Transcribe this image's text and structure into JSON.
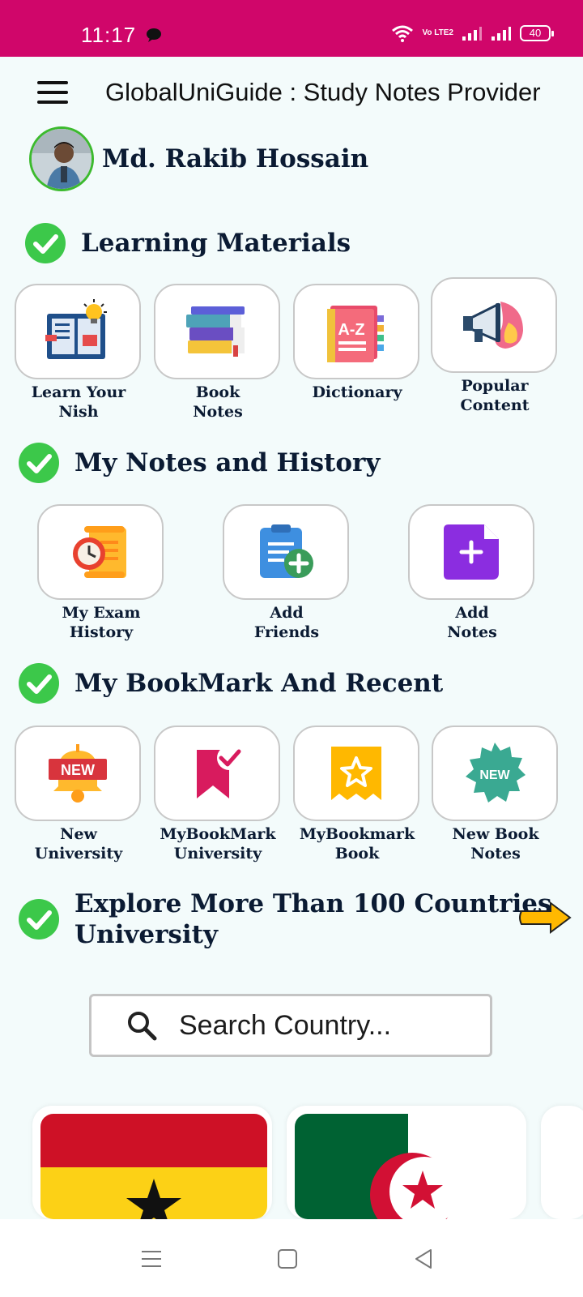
{
  "status": {
    "time": "11:17",
    "volte": "Vo LTE2",
    "battery": "40"
  },
  "app": {
    "title": "GlobalUniGuide : Study Notes Provider"
  },
  "profile": {
    "name": "Md. Rakib Hossain"
  },
  "sections": {
    "learning": {
      "title": "Learning Materials",
      "items": [
        {
          "label": "Learn Your\nNish",
          "icon": "learn-book-icon"
        },
        {
          "label": "Book\nNotes",
          "icon": "books-stack-icon"
        },
        {
          "label": "Dictionary",
          "icon": "dictionary-icon"
        },
        {
          "label": "Popular\nContent",
          "icon": "megaphone-icon"
        }
      ]
    },
    "notes": {
      "title": "My Notes and History",
      "items": [
        {
          "label": "My Exam\nHistory",
          "icon": "exam-history-icon"
        },
        {
          "label": "Add\nFriends",
          "icon": "add-friends-icon"
        },
        {
          "label": "Add\nNotes",
          "icon": "add-notes-icon"
        }
      ]
    },
    "bookmark": {
      "title": "My BookMark And Recent",
      "items": [
        {
          "label": "New\nUniversity",
          "icon": "new-bell-icon"
        },
        {
          "label": "MyBookMark\nUniversity",
          "icon": "bookmark-check-icon"
        },
        {
          "label": "MyBookmark\nBook",
          "icon": "bookmark-star-icon"
        },
        {
          "label": "New Book\nNotes",
          "icon": "new-badge-icon"
        }
      ]
    },
    "explore": {
      "title": "Explore More Than 100 Countries\nUniversity"
    }
  },
  "search": {
    "placeholder": "Search Country..."
  },
  "countries": [
    {
      "flag": "ghana-flag"
    },
    {
      "flag": "algeria-flag"
    }
  ],
  "colors": {
    "status_bar": "#d0066a",
    "check": "#3cc84a",
    "background": "#f3fbfb",
    "text": "#0b1b33"
  }
}
